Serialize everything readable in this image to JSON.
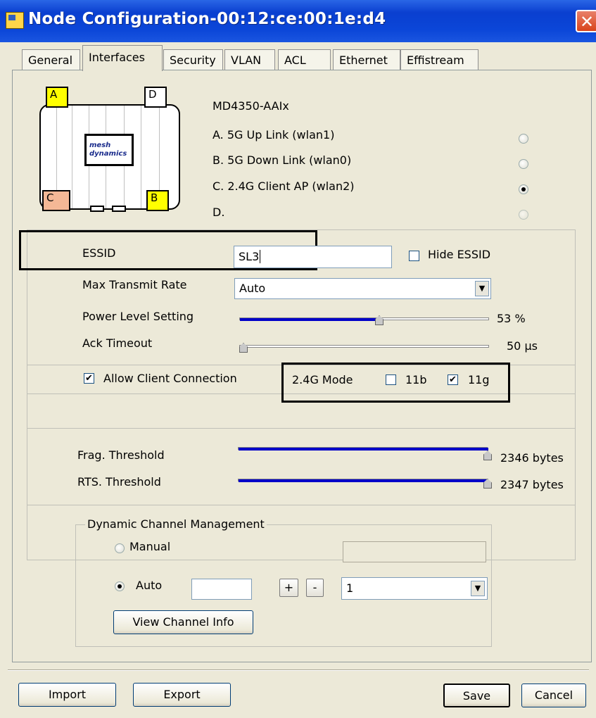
{
  "window": {
    "title": "Node Configuration-00:12:ce:00:1e:d4",
    "close_glyph": "✕"
  },
  "tabs": [
    {
      "label": "General"
    },
    {
      "label": "Interfaces",
      "active": true
    },
    {
      "label": "Security"
    },
    {
      "label": "VLAN"
    },
    {
      "label": "ACL"
    },
    {
      "label": "Ethernet"
    },
    {
      "label": "Effistream"
    }
  ],
  "device": {
    "model": "MD4350-AAIx",
    "corner_a": "A",
    "corner_b": "B",
    "corner_c": "C",
    "corner_d": "D",
    "logo_text_1": "mesh",
    "logo_text_2": "dynamics",
    "colors": {
      "corner_a": "#ffff00",
      "corner_b": "#ffff00",
      "corner_c": "#f4b896",
      "corner_d": "#ffffff"
    }
  },
  "interfaces": [
    {
      "label": "A. 5G  Up Link (wlan1)",
      "selected": false
    },
    {
      "label": "B. 5G  Down Link (wlan0)",
      "selected": false
    },
    {
      "label": "C. 2.4G  Client AP (wlan2)",
      "selected": true
    },
    {
      "label": "D.",
      "selected": false,
      "disabled": true
    }
  ],
  "settings": {
    "essid_label": "ESSID",
    "essid_value": "SL3",
    "hide_essid_label": "Hide ESSID",
    "hide_essid_checked": false,
    "max_rate_label": "Max Transmit Rate",
    "max_rate_value": "Auto",
    "power_label": "Power Level Setting",
    "power_value": "53 %",
    "power_fraction": 0.53,
    "ack_label": "Ack Timeout",
    "ack_value": "50 µs",
    "ack_fraction": 0.0
  },
  "client": {
    "allow_label": "Allow Client Connection",
    "allow_checked": true,
    "mode_label": "2.4G Mode",
    "b_label": "11b",
    "b_checked": false,
    "g_label": "11g",
    "g_checked": true
  },
  "thresholds": {
    "frag_label": "Frag. Threshold",
    "frag_value": "2346 bytes",
    "frag_fraction": 1.0,
    "rts_label": "RTS. Threshold",
    "rts_value": "2347 bytes",
    "rts_fraction": 1.0
  },
  "dcm": {
    "legend": "Dynamic Channel Management",
    "manual_label": "Manual",
    "manual_selected": false,
    "auto_label": "Auto",
    "auto_selected": true,
    "plus_label": "+",
    "minus_label": "-",
    "channel_value": "1",
    "view_button": "View Channel Info"
  },
  "buttons": {
    "import": "Import",
    "export": "Export",
    "save": "Save",
    "cancel": "Cancel"
  },
  "check_glyph": "✔",
  "arrow_glyph": "▼"
}
